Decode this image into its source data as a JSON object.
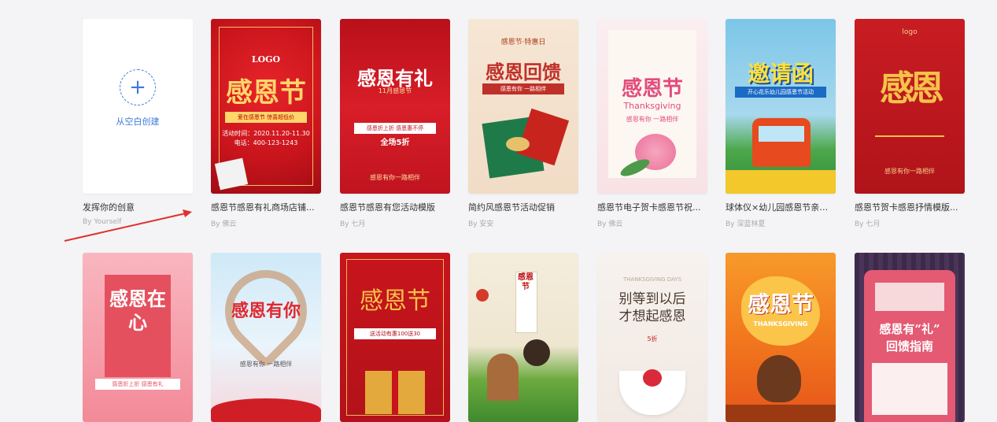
{
  "blank": {
    "label": "从空白创建",
    "plus": "+"
  },
  "row1": [
    {
      "caption": "发挥你的创意",
      "author": "By Yourself"
    },
    {
      "caption": "感恩节感恩有礼商场店铺...",
      "author": "By 佛云",
      "poster": {
        "logo": "LOGO",
        "title": "感恩节",
        "ribbon": "爱在感恩节 惊喜超低价",
        "lines": [
          "活动时间：2020.11.20-11.30",
          "电话：400-123-1243"
        ]
      }
    },
    {
      "caption": "感恩节感恩有您活动模版",
      "author": "By 七月",
      "poster": {
        "title": "感恩有礼",
        "sub": "11月感恩节",
        "ribbon": "感恩折上折  感恩惠不停",
        "lines": [
          "全场5折",
          "感恩有你一路相伴"
        ]
      }
    },
    {
      "caption": "简约风感恩节活动促销",
      "author": "By 安安",
      "poster": {
        "top": "感恩节·特惠日",
        "title": "感恩回馈",
        "ribbon": "感恩有你  一路相伴"
      }
    },
    {
      "caption": "感恩节电子贺卡感恩节祝...",
      "author": "By 佛云",
      "poster": {
        "title": "感恩节",
        "sub": "Thanksgiving",
        "ribbon": "感恩有你 一路相伴"
      }
    },
    {
      "caption": "球体仪×幼儿园感恩节亲子...",
      "author": "By 深蓝林夏",
      "poster": {
        "title": "邀请函",
        "ribbon": "开心花乐幼儿园感恩节活动"
      }
    },
    {
      "caption": "感恩节贺卡感恩抒情模版...",
      "author": "By 七月",
      "poster": {
        "logo": "logo",
        "title": "感恩",
        "lines": [
          "感恩有你一路相伴"
        ]
      }
    }
  ],
  "row2": [
    {
      "poster": {
        "title": "感恩在心",
        "ribbon": "感恩折上折  感恩有礼"
      }
    },
    {
      "poster": {
        "title": "感恩有你",
        "sub": "感恩有你  一路相伴"
      }
    },
    {
      "poster": {
        "title": "感恩节",
        "ribbon": "送活动有惠100送30"
      }
    },
    {
      "poster": {
        "title": "感恩节"
      }
    },
    {
      "poster": {
        "top": "THANKSGIVING DAYS",
        "title": "别等到以后",
        "title2": "才想起感恩",
        "sub": "5折"
      }
    },
    {
      "poster": {
        "title": "感恩节",
        "sub": "THANKSGIVING"
      }
    },
    {
      "poster": {
        "title": "感恩有“礼”",
        "title2": "回馈指南"
      }
    }
  ],
  "colors": {
    "accent": "#3f7bd9",
    "arrow": "#e0312e"
  }
}
